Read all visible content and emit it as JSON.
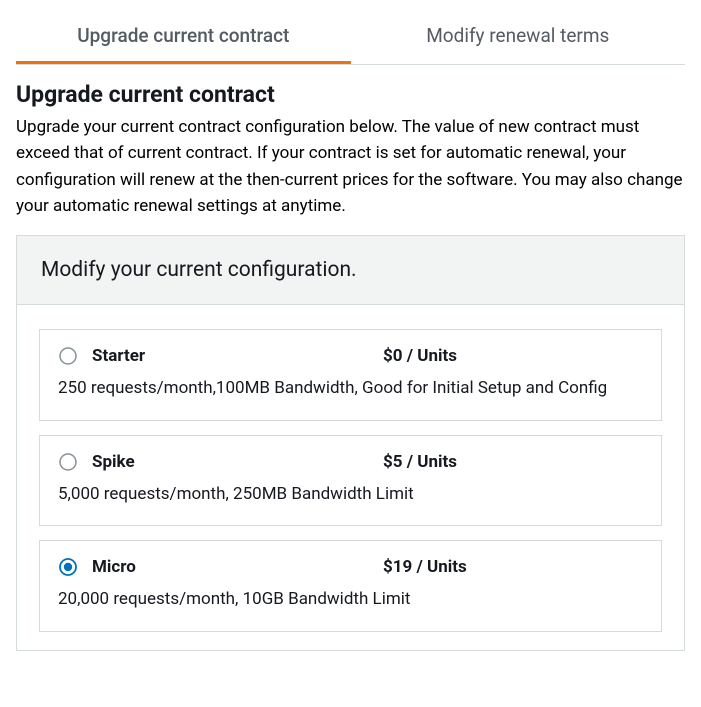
{
  "tabs": {
    "upgrade": "Upgrade current contract",
    "modify": "Modify renewal terms"
  },
  "page": {
    "title": "Upgrade current contract",
    "description": "Upgrade your current contract configuration below. The value of new contract must exceed that of current contract. If your contract is set for automatic renewal, your configuration will renew at the then-current prices for the software. You may also change your automatic renewal settings at anytime."
  },
  "panel": {
    "header": "Modify your current configuration."
  },
  "options": [
    {
      "name": "Starter",
      "price": "$0 / Units",
      "desc": "250 requests/month,100MB Bandwidth, Good for Initial Setup and Config",
      "selected": false
    },
    {
      "name": "Spike",
      "price": "$5 / Units",
      "desc": "5,000 requests/month, 250MB Bandwidth Limit",
      "selected": false
    },
    {
      "name": "Micro",
      "price": "$19 / Units",
      "desc": "20,000 requests/month, 10GB Bandwidth Limit",
      "selected": true
    }
  ]
}
